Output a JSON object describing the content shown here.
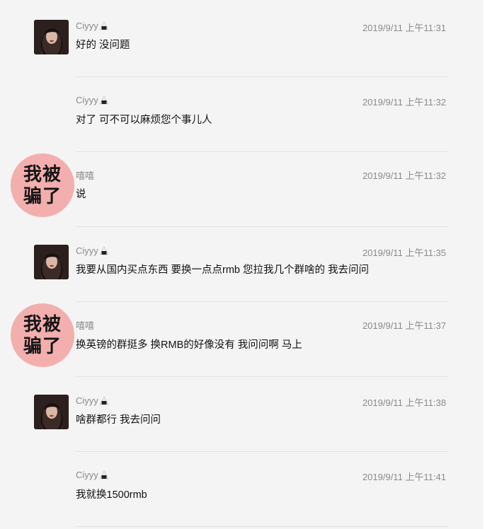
{
  "messages": [
    {
      "sender": "Ciyyy",
      "has_onigiri": true,
      "time": "2019/9/11 上午11:31",
      "text": "好的 没问题",
      "avatar": "photo"
    },
    {
      "sender": "Ciyyy",
      "has_onigiri": true,
      "time": "2019/9/11 上午11:32",
      "text": "对了 可不可以麻烦您个事儿人",
      "avatar": "none"
    },
    {
      "sender": "嘻嘻",
      "has_onigiri": false,
      "time": "2019/9/11 上午11:32",
      "text": "说",
      "avatar": "sticker"
    },
    {
      "sender": "Ciyyy",
      "has_onigiri": true,
      "time": "2019/9/11 上午11:35",
      "text": "我要从国内买点东西 要换一点点rmb 您拉我几个群啥的 我去问问",
      "avatar": "photo"
    },
    {
      "sender": "嘻嘻",
      "has_onigiri": false,
      "time": "2019/9/11 上午11:37",
      "text": "换英镑的群挺多 换RMB的好像没有 我问问啊 马上",
      "avatar": "sticker"
    },
    {
      "sender": "Ciyyy",
      "has_onigiri": true,
      "time": "2019/9/11 上午11:38",
      "text": "啥群都行 我去问问",
      "avatar": "photo"
    },
    {
      "sender": "Ciyyy",
      "has_onigiri": true,
      "time": "2019/9/11 上午11:41",
      "text": "我就换1500rmb",
      "avatar": "none"
    }
  ],
  "sticker_text_line1": "我被",
  "sticker_text_line2": "骗了",
  "colors": {
    "sticker_bg": "#f3aeae",
    "background": "#f4f4f4",
    "meta_text": "#8a8a8a"
  }
}
